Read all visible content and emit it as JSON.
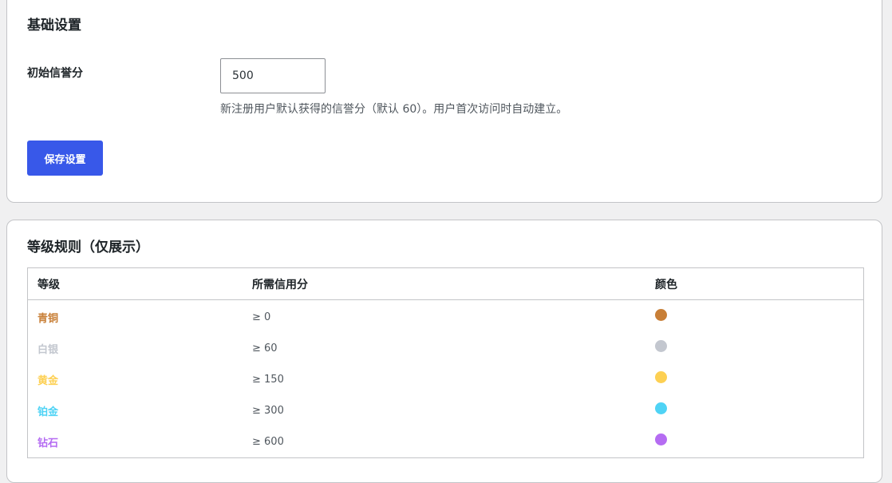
{
  "basic_settings": {
    "title": "基础设置",
    "initial_score_label": "初始信誉分",
    "initial_score_value": "500",
    "help_text": "新注册用户默认获得的信誉分（默认 60）。用户首次访问时自动建立。",
    "save_label": "保存设置"
  },
  "level_rules": {
    "title": "等级规则（仅展示）",
    "columns": [
      "等级",
      "所需信用分",
      "颜色"
    ],
    "rows": [
      {
        "name": "青铜",
        "requirement": "≥ 0",
        "color": "#c87f37"
      },
      {
        "name": "白银",
        "requirement": "≥ 60",
        "color": "#c3c7cf"
      },
      {
        "name": "黄金",
        "requirement": "≥ 150",
        "color": "#fdd053"
      },
      {
        "name": "铂金",
        "requirement": "≥ 300",
        "color": "#4fd3f5"
      },
      {
        "name": "钻石",
        "requirement": "≥ 600",
        "color": "#b56cf2"
      }
    ]
  },
  "colors": {
    "accent": "#3858e9",
    "border": "#c3c4c7",
    "page_background": "#f0f0f1"
  }
}
